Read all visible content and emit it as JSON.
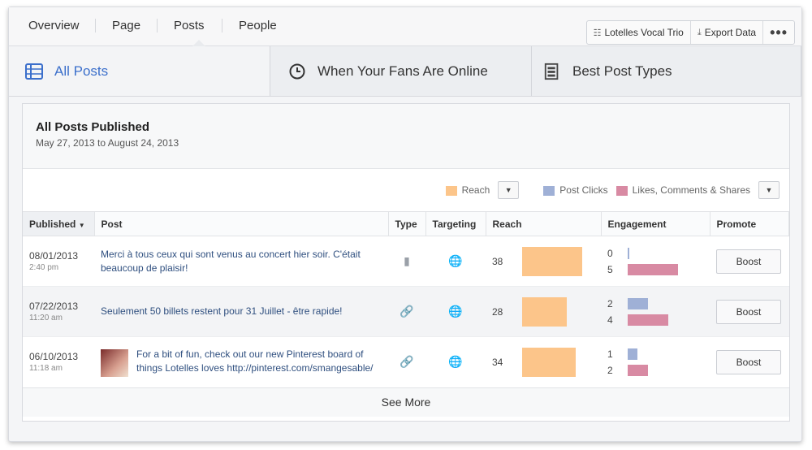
{
  "nav": {
    "tabs": [
      {
        "label": "Overview"
      },
      {
        "label": "Page"
      },
      {
        "label": "Posts"
      },
      {
        "label": "People"
      }
    ],
    "active_tab": "Posts",
    "page_name": "Lotelles Vocal Trio",
    "export_label": "Export Data",
    "more_label": "•••"
  },
  "subtabs": [
    {
      "label": "All Posts",
      "icon": "table-icon"
    },
    {
      "label": "When Your Fans Are Online",
      "icon": "clock-icon"
    },
    {
      "label": "Best Post Types",
      "icon": "post-types-icon"
    }
  ],
  "card": {
    "title": "All Posts Published",
    "date_range": "May 27, 2013 to August 24, 2013"
  },
  "legend": {
    "reach": "Reach",
    "post_clicks": "Post Clicks",
    "likes": "Likes, Comments & Shares"
  },
  "colors": {
    "reach": "#fcc58a",
    "post_clicks": "#9fb0d6",
    "likes": "#d88aa3",
    "accent": "#3b6fcb"
  },
  "table": {
    "headers": {
      "published": "Published",
      "post": "Post",
      "type": "Type",
      "targeting": "Targeting",
      "reach": "Reach",
      "engagement": "Engagement",
      "promote": "Promote"
    },
    "rows": [
      {
        "date": "08/01/2013",
        "time": "2:40 pm",
        "text": "Merci à tous ceux qui sont venus au concert hier soir. C'était beaucoup de plaisir!",
        "type_icon": "status-icon",
        "has_thumb": false,
        "reach": 38,
        "post_clicks": 0,
        "likes": 5,
        "boost": "Boost"
      },
      {
        "date": "07/22/2013",
        "time": "11:20 am",
        "text": "Seulement 50 billets restent pour 31 Juillet - être rapide!",
        "type_icon": "link-icon",
        "has_thumb": false,
        "reach": 28,
        "post_clicks": 2,
        "likes": 4,
        "boost": "Boost"
      },
      {
        "date": "06/10/2013",
        "time": "11:18 am",
        "text": "For a bit of fun, check out our new Pinterest board of things Lotelles loves http://pinterest.com/smangesable/",
        "type_icon": "link-icon",
        "has_thumb": true,
        "reach": 34,
        "post_clicks": 1,
        "likes": 2,
        "boost": "Boost"
      }
    ]
  },
  "see_more": "See More"
}
